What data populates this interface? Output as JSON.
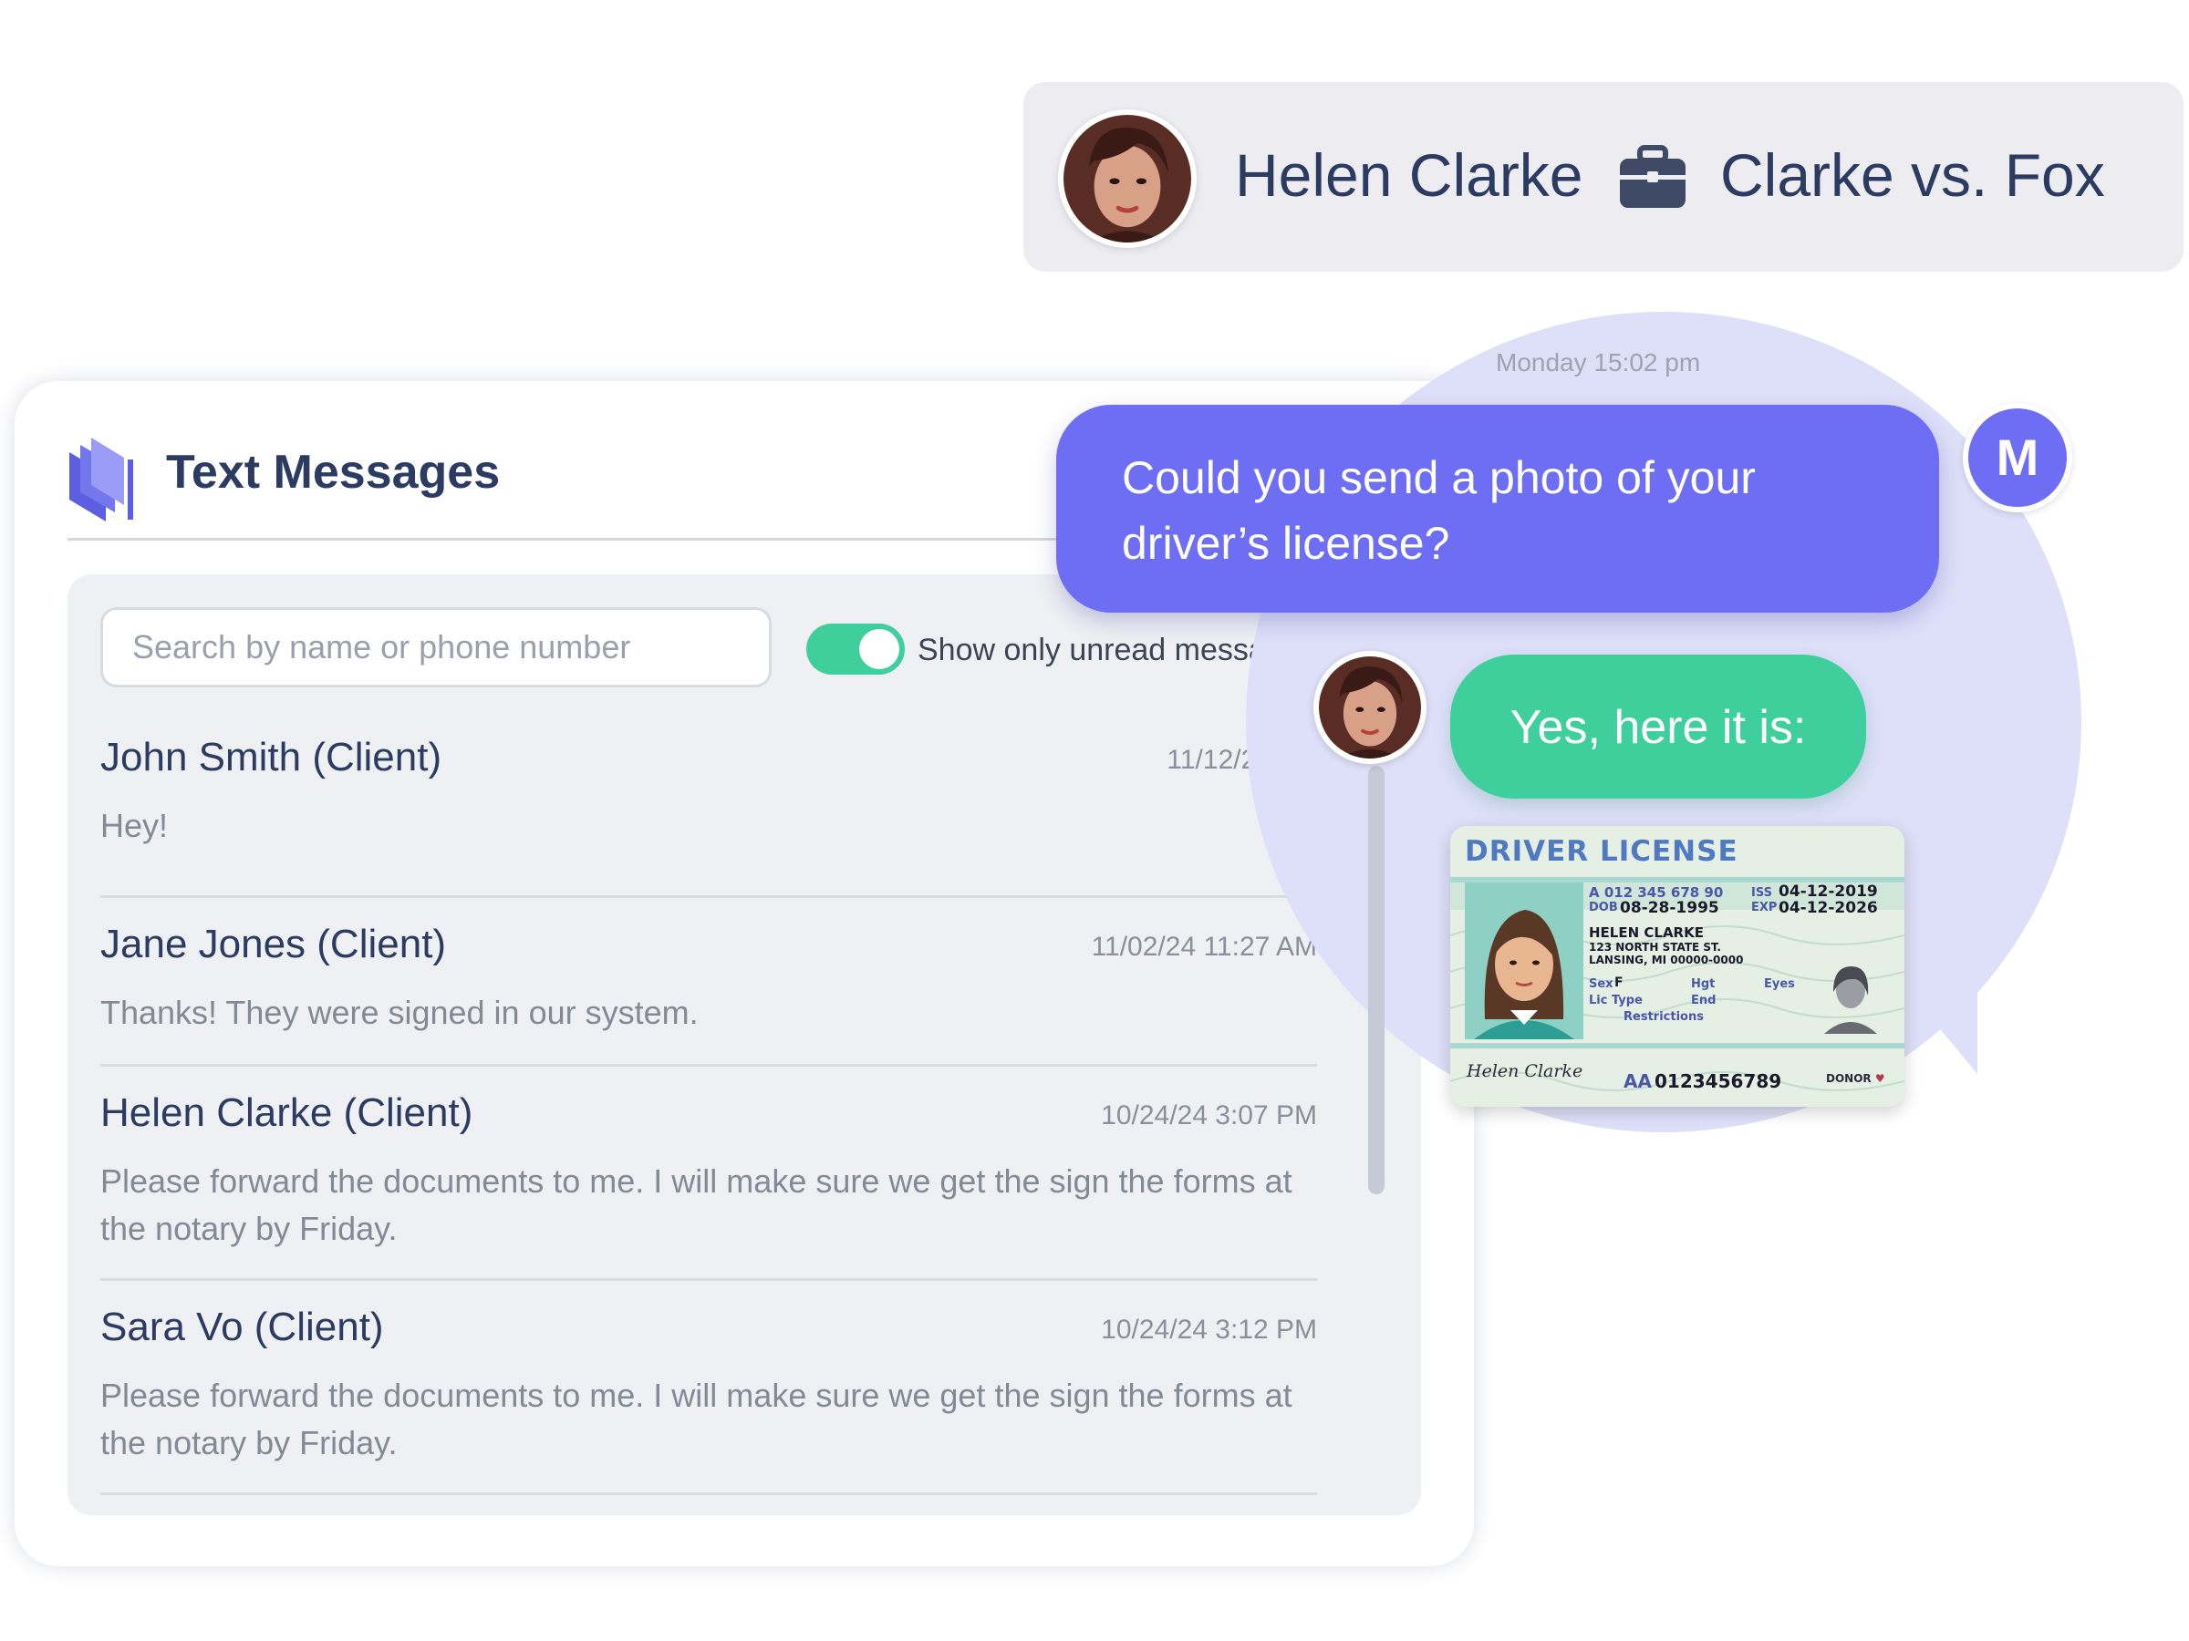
{
  "header": {
    "name": "Helen Clarke",
    "case": "Clarke vs. Fox",
    "avatar_icon": "avatar-helen",
    "case_icon": "briefcase-icon"
  },
  "panel": {
    "title": "Text Messages",
    "logo_icon": "book-stack-icon",
    "search_placeholder": "Search by name or phone number",
    "search_value": "",
    "toggle_label": "Show only unread messages",
    "toggle_on": true,
    "messages": [
      {
        "name": "John Smith (Client)",
        "time": "11/12/24 5:2",
        "body": "Hey!"
      },
      {
        "name": "Jane Jones (Client)",
        "time": "11/02/24 11:27 AM",
        "body": "Thanks! They were signed in our system."
      },
      {
        "name": "Helen Clarke (Client)",
        "time": "10/24/24 3:07 PM",
        "body": "Please forward the documents to me. I will make sure we get the sign the forms at the notary by Friday."
      },
      {
        "name": "Sara Vo (Client)",
        "time": "10/24/24 3:12 PM",
        "body": "Please forward the documents to me. I will make sure we get the sign the forms at the notary by Friday."
      }
    ]
  },
  "chat": {
    "timestamp": "Monday 15:02 pm",
    "outgoing_text": "Could you send a photo of your driver’s license?",
    "sender_initial": "M",
    "reply_text": "Yes, here it is:"
  },
  "license": {
    "title": "DRIVER LICENSE",
    "id_line": "A 012 345 678 90",
    "dob_label": "DOB",
    "dob": "08-28-1995",
    "iss_label": "ISS",
    "iss": "04-12-2019",
    "exp_label": "EXP",
    "exp": "04-12-2026",
    "holder": "HELEN CLARKE",
    "address1": "123 NORTH STATE ST.",
    "address2": "LANSING, MI 00000-0000",
    "sex_label": "Sex",
    "sex": "F",
    "hgt_label": "Hgt",
    "eyes_label": "Eyes",
    "lic_type_label": "Lic Type",
    "end_label": "End",
    "restrictions_label": "Restrictions",
    "signature": "Helen Clarke",
    "number_label": "AA",
    "number": "0123456789",
    "donor": "DONOR",
    "heart": "♥"
  },
  "colors": {
    "brand_purple": "#6e6ef4",
    "accent_green": "#3ecf9c",
    "text_navy": "#2c3b61",
    "blob": "#dedff8"
  }
}
